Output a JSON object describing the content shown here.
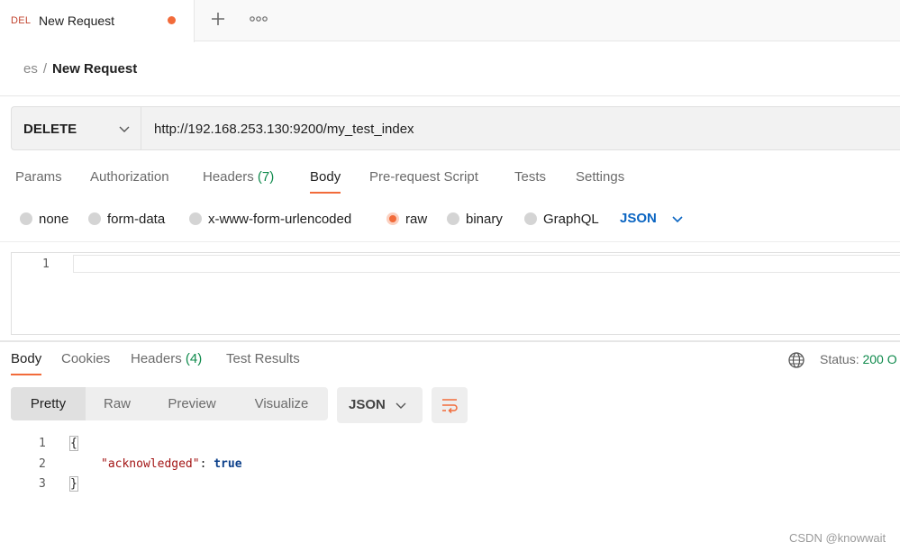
{
  "tab": {
    "method": "DEL",
    "title": "New Request"
  },
  "breadcrumb": {
    "collection": "es",
    "separator": "/",
    "current": "New Request"
  },
  "request": {
    "method": "DELETE",
    "url": "http://192.168.253.130:9200/my_test_index",
    "tabs": [
      {
        "label": "Params"
      },
      {
        "label": "Authorization"
      },
      {
        "label": "Headers",
        "count": "(7)"
      },
      {
        "label": "Body"
      },
      {
        "label": "Pre-request Script"
      },
      {
        "label": "Tests"
      },
      {
        "label": "Settings"
      }
    ],
    "body_types": [
      "none",
      "form-data",
      "x-www-form-urlencoded",
      "raw",
      "binary",
      "GraphQL"
    ],
    "selected_body_type": "raw",
    "body_format": "JSON",
    "editor_line": "1"
  },
  "response": {
    "tabs": [
      {
        "label": "Body"
      },
      {
        "label": "Cookies"
      },
      {
        "label": "Headers",
        "count": "(4)"
      },
      {
        "label": "Test Results"
      }
    ],
    "status_label": "Status:",
    "status_value": "200 O",
    "view_modes": [
      "Pretty",
      "Raw",
      "Preview",
      "Visualize"
    ],
    "format": "JSON",
    "code": {
      "line_numbers": [
        "1",
        "2",
        "3"
      ],
      "open_brace": "{",
      "key": "\"acknowledged\"",
      "colon": ": ",
      "value": "true",
      "close_brace": "}"
    }
  },
  "watermark": "CSDN @knowwait",
  "colors": {
    "accent": "#f26b3a",
    "method_delete": "#c1432e",
    "link_blue": "#0b65c2",
    "status_green": "#0f8a4c"
  },
  "icons": [
    "plus-icon",
    "more-icon",
    "chevron-down-icon",
    "globe-icon",
    "wrap-lines-icon"
  ]
}
